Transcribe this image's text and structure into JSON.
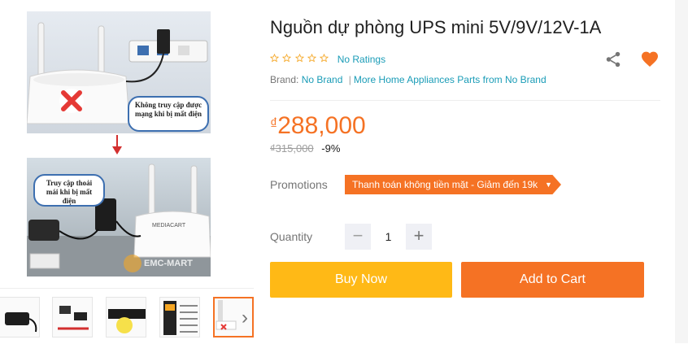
{
  "product": {
    "title": "Nguồn dự phòng UPS mini 5V/9V/12V-1A",
    "ratings_text": "No Ratings",
    "star_count": 5,
    "brand_label": "Brand:",
    "brand_name": "No Brand",
    "more_link": "More Home Appliances Parts from No Brand"
  },
  "price": {
    "currency": "₫",
    "current": "288,000",
    "original": "₫315,000",
    "discount": "-9%"
  },
  "promotions": {
    "label": "Promotions",
    "tag_text": "Thanh toán không tiền mặt - Giảm đến 19k"
  },
  "quantity": {
    "label": "Quantity",
    "value": "1",
    "minus": "−",
    "plus": "+"
  },
  "actions": {
    "buy_now": "Buy Now",
    "add_to_cart": "Add to Cart"
  },
  "gallery": {
    "callout_top": "Không truy cập được mạng khi bị mất điện",
    "callout_bottom": "Truy cập thoải mái khi bị mất điện",
    "watermark": "EMC-MART",
    "router_brand": "MEDIACART",
    "next_arrow": "›",
    "thumbnail_count": 6,
    "active_thumbnail": 5
  },
  "colors": {
    "accent": "#f57224",
    "buy_now": "#ffb916",
    "link": "#1a9cb7"
  },
  "icons": [
    "star-icon",
    "share-icon",
    "heart-icon",
    "caret-down-icon",
    "chevron-right-icon"
  ]
}
